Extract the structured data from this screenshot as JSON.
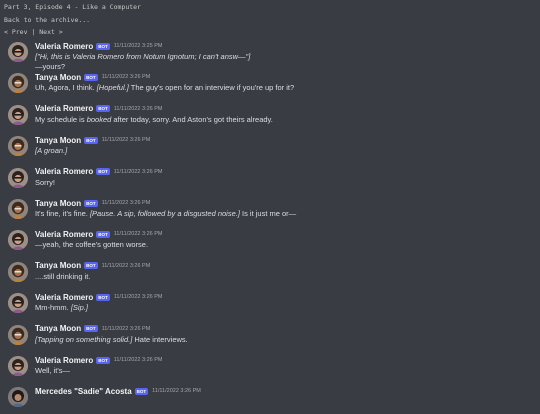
{
  "header": {
    "title": "Part 3, Episode 4 - Like a Computer",
    "back": "Back to the archive...",
    "prev": "< Prev",
    "sep": "|",
    "next": "Next >"
  },
  "bot_badge": "BOT",
  "messages": [
    {
      "author": "Valeria Romero",
      "time": "11/11/2022 3:25 PM",
      "avatar": "valeria",
      "lines": [
        [
          {
            "t": "[\"Hi, this is Valeria Romero from Notum Ignotum; I can't answ—\"]",
            "i": true
          }
        ],
        [
          {
            "t": "—yours?",
            "i": false
          }
        ]
      ]
    },
    {
      "author": "Tanya Moon",
      "time": "11/11/2022 3:26 PM",
      "avatar": "tanya",
      "lines": [
        [
          {
            "t": "Uh, Agora, I think. ",
            "i": false
          },
          {
            "t": "[Hopeful.]",
            "i": true
          },
          {
            "t": " The guy's open for an interview if you're up for it?",
            "i": false
          }
        ]
      ]
    },
    {
      "author": "Valeria Romero",
      "time": "11/11/2022 3:26 PM",
      "avatar": "valeria",
      "lines": [
        [
          {
            "t": "My schedule is ",
            "i": false
          },
          {
            "t": "booked",
            "i": true
          },
          {
            "t": " after today, sorry. And Aston's got theirs already.",
            "i": false
          }
        ]
      ]
    },
    {
      "author": "Tanya Moon",
      "time": "11/11/2022 3:26 PM",
      "avatar": "tanya",
      "lines": [
        [
          {
            "t": "[A groan.]",
            "i": true
          }
        ]
      ]
    },
    {
      "author": "Valeria Romero",
      "time": "11/11/2022 3:26 PM",
      "avatar": "valeria",
      "lines": [
        [
          {
            "t": "Sorry!",
            "i": false
          }
        ]
      ]
    },
    {
      "author": "Tanya Moon",
      "time": "11/11/2022 3:26 PM",
      "avatar": "tanya",
      "lines": [
        [
          {
            "t": "It's fine, it's fine. ",
            "i": false
          },
          {
            "t": "[Pause. A sip, followed by a disgusted noise.]",
            "i": true
          },
          {
            "t": " Is it just me or—",
            "i": false
          }
        ]
      ]
    },
    {
      "author": "Valeria Romero",
      "time": "11/11/2022 3:26 PM",
      "avatar": "valeria",
      "lines": [
        [
          {
            "t": "—yeah, the coffee's gotten worse.",
            "i": false
          }
        ]
      ]
    },
    {
      "author": "Tanya Moon",
      "time": "11/11/2022 3:26 PM",
      "avatar": "tanya",
      "lines": [
        [
          {
            "t": "....still drinking it.",
            "i": false
          }
        ]
      ]
    },
    {
      "author": "Valeria Romero",
      "time": "11/11/2022 3:26 PM",
      "avatar": "valeria",
      "lines": [
        [
          {
            "t": "Mm-hmm. ",
            "i": false
          },
          {
            "t": "[Sip.]",
            "i": true
          }
        ]
      ]
    },
    {
      "author": "Tanya Moon",
      "time": "11/11/2022 3:26 PM",
      "avatar": "tanya",
      "lines": [
        [
          {
            "t": "[Tapping on something solid.]",
            "i": true
          },
          {
            "t": " Hate interviews.",
            "i": false
          }
        ]
      ]
    },
    {
      "author": "Valeria Romero",
      "time": "11/11/2022 3:26 PM",
      "avatar": "valeria",
      "lines": [
        [
          {
            "t": "Well, it's—",
            "i": false
          }
        ]
      ]
    },
    {
      "author": "Mercedes \"Sadie\" Acosta",
      "time": "11/11/2022 3:26 PM",
      "avatar": "sadie",
      "lines": []
    }
  ],
  "colors": {
    "background": "#3a3c43",
    "bot_badge": "#5865f2",
    "name": "#f2f3f5",
    "text": "#dbdee1",
    "timestamp": "#a3a6aa"
  }
}
